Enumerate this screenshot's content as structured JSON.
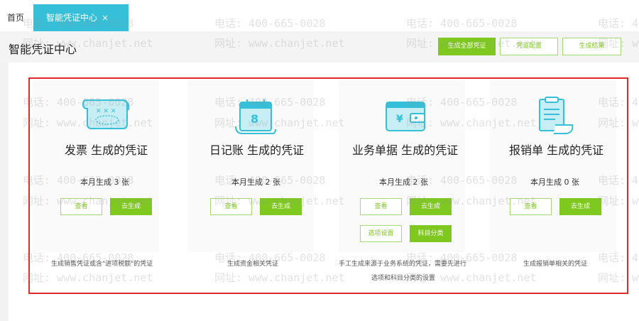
{
  "tabs": {
    "home": "首页",
    "active": "智能凭证中心",
    "close": "×"
  },
  "page": {
    "title": "智能凭证中心"
  },
  "header_buttons": {
    "generate_all": "生成全部凭证",
    "config": "凭证配置",
    "result": "生成结果"
  },
  "cards": [
    {
      "title": "发票 生成的凭证",
      "count": "本月生成 3 张",
      "view": "查看",
      "generate": "去生成",
      "desc": "生成销售凭证或含\"进项税额\"的凭证",
      "icon": "invoice-icon"
    },
    {
      "title": "日记账 生成的凭证",
      "count": "本月生成 2 张",
      "view": "查看",
      "generate": "去生成",
      "desc": "生成资金相关凭证",
      "icon": "calendar-icon"
    },
    {
      "title": "业务单据 生成的凭证",
      "count": "本月生成  2 张",
      "view": "查看",
      "generate": "去生成",
      "options": "选项设置",
      "subject": "科目分类",
      "desc_line1": "手工生成来源于业务系统的凭证，需要先进行",
      "desc_line2": "选项和科目分类的设置",
      "icon": "wallet-icon"
    },
    {
      "title": "报销单 生成的凭证",
      "count": "本月生成  0 张",
      "view": "查看",
      "generate": "去生成",
      "desc": "生成报销单相关的凭证",
      "icon": "receipt-icon"
    }
  ],
  "watermark": {
    "phone": "电话: 400-665-0028",
    "site": "网址: www.chanjet.net"
  },
  "colors": {
    "accent": "#7ec820",
    "tab": "#35bfd8",
    "highlight": "#e12a2a",
    "icon": "#35bfd8"
  }
}
